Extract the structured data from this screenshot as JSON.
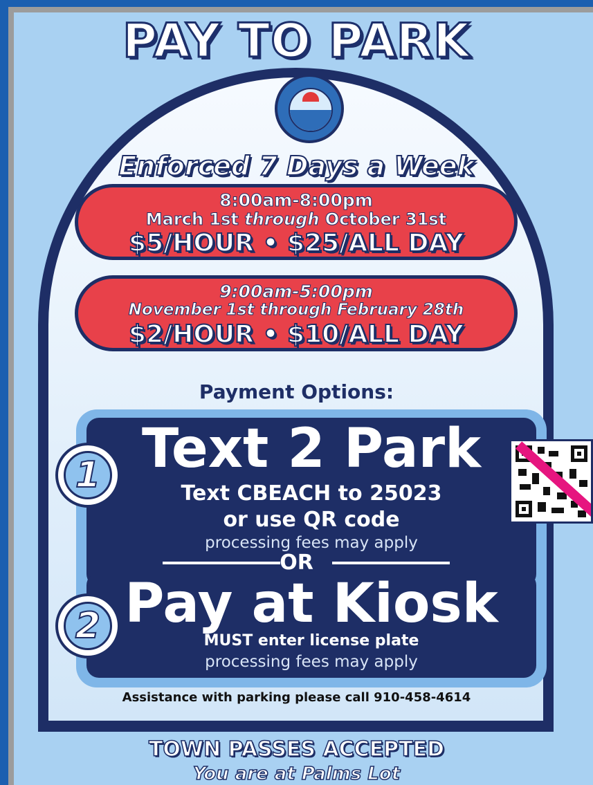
{
  "sign": {
    "title": "PAY TO PARK",
    "seal_icon": "town-seal",
    "enforced": "Enforced 7 Days a Week",
    "rates": [
      {
        "hours": "8:00am-8:00pm",
        "dates_pre": "March 1st ",
        "dates_italic": "through",
        "dates_post": " October 31st",
        "price": "$5/HOUR • $25/ALL DAY"
      },
      {
        "hours": "9:00am-5:00pm",
        "dates": "November 1st through February 28th",
        "price": "$2/HOUR • $10/ALL DAY"
      }
    ],
    "payment_heading": "Payment Options:",
    "options": [
      {
        "number": "1",
        "title": "Text 2 Park",
        "line1": "Text CBEACH to 25023",
        "line2": "or use QR code",
        "note": "processing fees may apply"
      },
      {
        "number": "2",
        "title": "Pay at Kiosk",
        "line1": "MUST enter license plate",
        "note": "processing fees may apply"
      }
    ],
    "or_label": "OR",
    "assistance": "Assistance with parking please call 910-458-4614",
    "passes": "TOWN PASSES ACCEPTED",
    "location": "You are at Palms Lot"
  },
  "colors": {
    "background": "#1b5fb0",
    "panel": "#a9d1f2",
    "navy": "#1e2e66",
    "red": "#e8414a",
    "qr_slash": "#e6157f"
  }
}
